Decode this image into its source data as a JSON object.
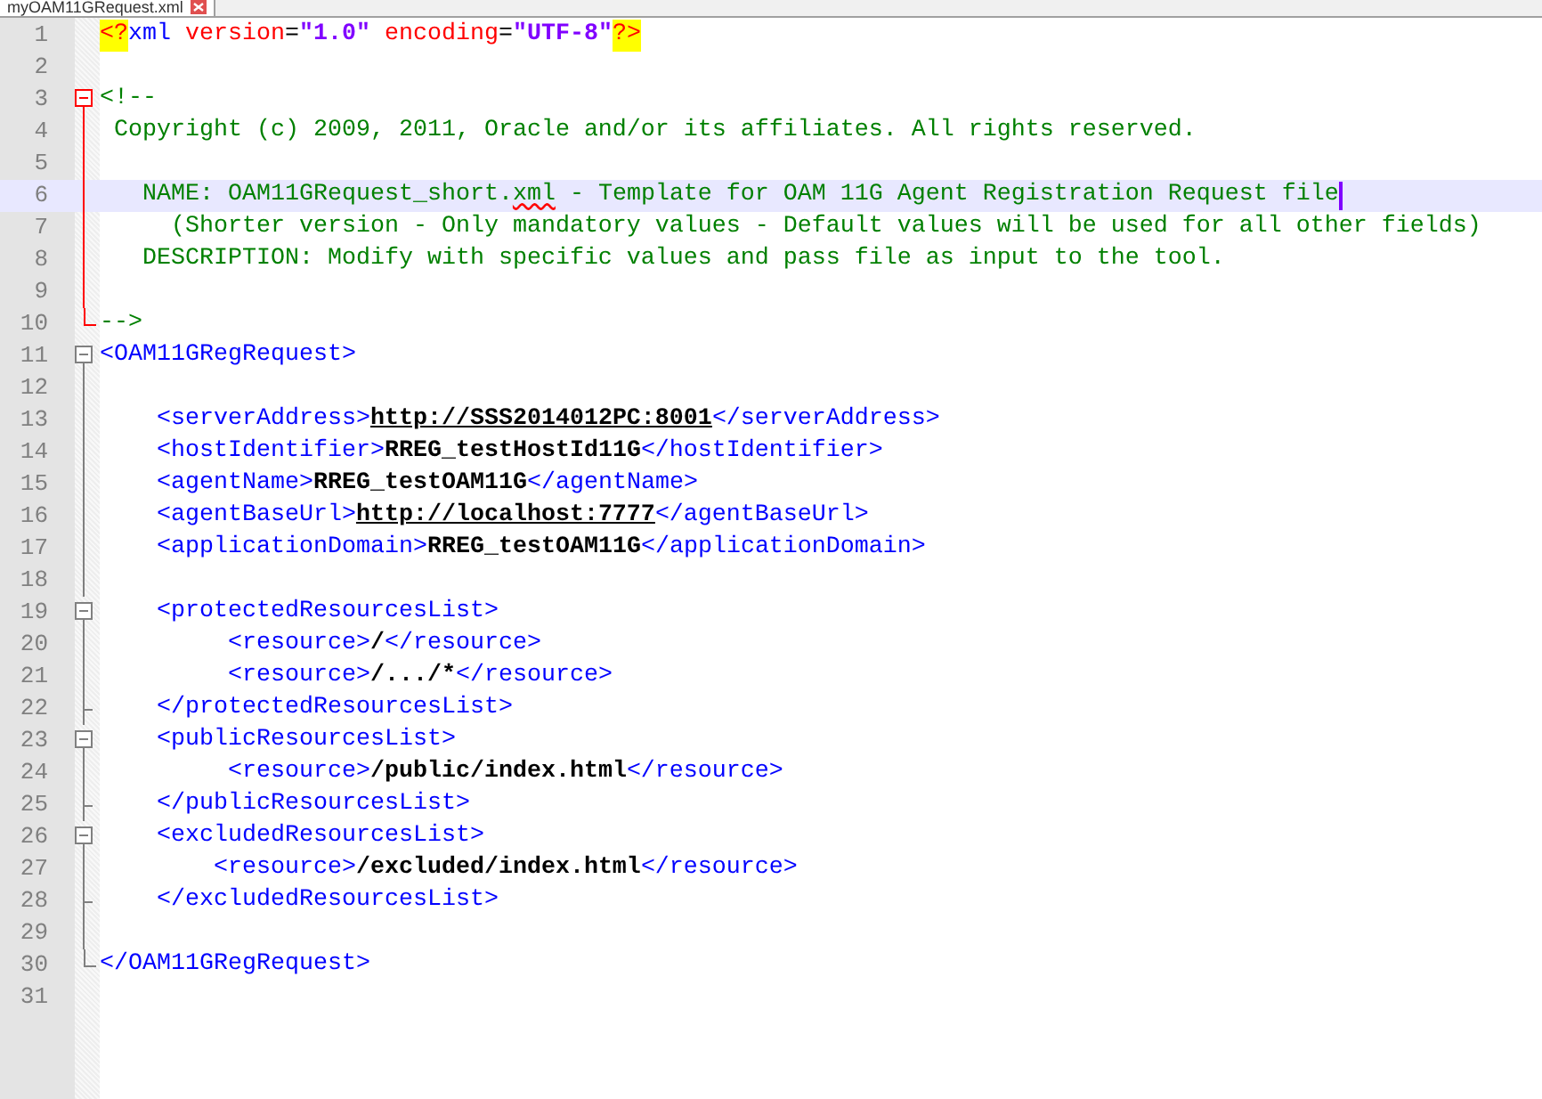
{
  "tab": {
    "label": "myOAM11GRequest.xml"
  },
  "lines": [
    {
      "number": "1",
      "tokens": [
        {
          "kind": "pi",
          "text": "<?"
        },
        {
          "kind": "tag",
          "text": "xml"
        },
        {
          "kind": "attr",
          "text": " version"
        },
        {
          "kind": "plain",
          "text": "="
        },
        {
          "kind": "value",
          "text": "\"1.0\""
        },
        {
          "kind": "attr",
          "text": " encoding"
        },
        {
          "kind": "plain",
          "text": "="
        },
        {
          "kind": "value",
          "text": "\"UTF-8\""
        },
        {
          "kind": "pi",
          "text": "?>"
        }
      ]
    },
    {
      "number": "2"
    },
    {
      "number": "3",
      "fold": {
        "kind": "start",
        "highlighted": true
      },
      "tokens": [
        {
          "kind": "comment",
          "text": "<!--"
        }
      ]
    },
    {
      "number": "4",
      "fold": {
        "kind": "middle",
        "highlighted": true
      },
      "tokens": [
        {
          "kind": "comment",
          "text": " Copyright (c) 2009, 2011, Oracle and/or its affiliates. All rights reserved."
        }
      ]
    },
    {
      "number": "5",
      "fold": {
        "kind": "middle",
        "highlighted": true
      }
    },
    {
      "number": "6",
      "fold": {
        "kind": "middle",
        "highlighted": true
      },
      "current": true,
      "caret": true,
      "tokens": [
        {
          "kind": "comment",
          "text": "   NAME: OAM11GRequest_short."
        },
        {
          "kind": "misspelled",
          "text": "xml"
        },
        {
          "kind": "comment",
          "text": " - Template for OAM 11G Agent Registration Request file"
        }
      ]
    },
    {
      "number": "7",
      "fold": {
        "kind": "middle",
        "highlighted": true
      },
      "tokens": [
        {
          "kind": "comment",
          "text": "     (Shorter version - Only mandatory values - Default values will be used for all other fields)"
        }
      ]
    },
    {
      "number": "8",
      "fold": {
        "kind": "middle",
        "highlighted": true
      },
      "tokens": [
        {
          "kind": "comment",
          "text": "   DESCRIPTION: Modify with specific values and pass file as input to the tool."
        }
      ]
    },
    {
      "number": "9",
      "fold": {
        "kind": "middle",
        "highlighted": true
      }
    },
    {
      "number": "10",
      "fold": {
        "kind": "end",
        "highlighted": true
      },
      "tokens": [
        {
          "kind": "comment",
          "text": "-->"
        }
      ]
    },
    {
      "number": "11",
      "fold": {
        "kind": "start",
        "highlighted": false
      },
      "tokens": [
        {
          "kind": "tag",
          "text": "<OAM11GRegRequest>"
        }
      ]
    },
    {
      "number": "12",
      "fold": {
        "kind": "middle",
        "highlighted": false
      }
    },
    {
      "number": "13",
      "fold": {
        "kind": "middle",
        "highlighted": false
      },
      "tokens": [
        {
          "kind": "tag",
          "text": "    <serverAddress>"
        },
        {
          "kind": "url",
          "text": "http://SSS2014012PC:8001"
        },
        {
          "kind": "tag",
          "text": "</serverAddress>"
        }
      ]
    },
    {
      "number": "14",
      "fold": {
        "kind": "middle",
        "highlighted": false
      },
      "tokens": [
        {
          "kind": "tag",
          "text": "    <hostIdentifier>"
        },
        {
          "kind": "text",
          "text": "RREG_testHostId11G"
        },
        {
          "kind": "tag",
          "text": "</hostIdentifier>"
        }
      ]
    },
    {
      "number": "15",
      "fold": {
        "kind": "middle",
        "highlighted": false
      },
      "tokens": [
        {
          "kind": "tag",
          "text": "    <agentName>"
        },
        {
          "kind": "text",
          "text": "RREG_testOAM11G"
        },
        {
          "kind": "tag",
          "text": "</agentName>"
        }
      ]
    },
    {
      "number": "16",
      "fold": {
        "kind": "middle",
        "highlighted": false
      },
      "tokens": [
        {
          "kind": "tag",
          "text": "    <agentBaseUrl>"
        },
        {
          "kind": "url",
          "text": "http://localhost:7777"
        },
        {
          "kind": "tag",
          "text": "</agentBaseUrl>"
        }
      ]
    },
    {
      "number": "17",
      "fold": {
        "kind": "middle",
        "highlighted": false
      },
      "tokens": [
        {
          "kind": "tag",
          "text": "    <applicationDomain>"
        },
        {
          "kind": "text",
          "text": "RREG_testOAM11G"
        },
        {
          "kind": "tag",
          "text": "</applicationDomain>"
        }
      ]
    },
    {
      "number": "18",
      "fold": {
        "kind": "middle",
        "highlighted": false
      }
    },
    {
      "number": "19",
      "fold": {
        "kind": "start",
        "highlighted": false
      },
      "tokens": [
        {
          "kind": "tag",
          "text": "    <protectedResourcesList>"
        }
      ]
    },
    {
      "number": "20",
      "fold": {
        "kind": "middle",
        "highlighted": false
      },
      "tokens": [
        {
          "kind": "tag",
          "text": "         <resource>"
        },
        {
          "kind": "text",
          "text": "/"
        },
        {
          "kind": "tag",
          "text": "</resource>"
        }
      ]
    },
    {
      "number": "21",
      "fold": {
        "kind": "middle",
        "highlighted": false
      },
      "tokens": [
        {
          "kind": "tag",
          "text": "         <resource>"
        },
        {
          "kind": "text",
          "text": "/.../*"
        },
        {
          "kind": "tag",
          "text": "</resource>"
        }
      ]
    },
    {
      "number": "22",
      "fold": {
        "kind": "inner-end",
        "highlighted": false
      },
      "tokens": [
        {
          "kind": "tag",
          "text": "    </protectedResourcesList>"
        }
      ]
    },
    {
      "number": "23",
      "fold": {
        "kind": "start",
        "highlighted": false
      },
      "tokens": [
        {
          "kind": "tag",
          "text": "    <publicResourcesList>"
        }
      ]
    },
    {
      "number": "24",
      "fold": {
        "kind": "middle",
        "highlighted": false
      },
      "tokens": [
        {
          "kind": "tag",
          "text": "         <resource>"
        },
        {
          "kind": "text",
          "text": "/public/index.html"
        },
        {
          "kind": "tag",
          "text": "</resource>"
        }
      ]
    },
    {
      "number": "25",
      "fold": {
        "kind": "inner-end",
        "highlighted": false
      },
      "tokens": [
        {
          "kind": "tag",
          "text": "    </publicResourcesList>"
        }
      ]
    },
    {
      "number": "26",
      "fold": {
        "kind": "start",
        "highlighted": false
      },
      "tokens": [
        {
          "kind": "tag",
          "text": "    <excludedResourcesList>"
        }
      ]
    },
    {
      "number": "27",
      "fold": {
        "kind": "middle",
        "highlighted": false
      },
      "tokens": [
        {
          "kind": "tag",
          "text": "        <resource>"
        },
        {
          "kind": "text",
          "text": "/excluded/index.html"
        },
        {
          "kind": "tag",
          "text": "</resource>"
        }
      ]
    },
    {
      "number": "28",
      "fold": {
        "kind": "inner-end",
        "highlighted": false
      },
      "tokens": [
        {
          "kind": "tag",
          "text": "    </excludedResourcesList>"
        }
      ]
    },
    {
      "number": "29",
      "fold": {
        "kind": "middle",
        "highlighted": false
      }
    },
    {
      "number": "30",
      "fold": {
        "kind": "end",
        "highlighted": false
      },
      "tokens": [
        {
          "kind": "tag",
          "text": "</OAM11GRegRequest>"
        }
      ]
    },
    {
      "number": "31"
    }
  ]
}
